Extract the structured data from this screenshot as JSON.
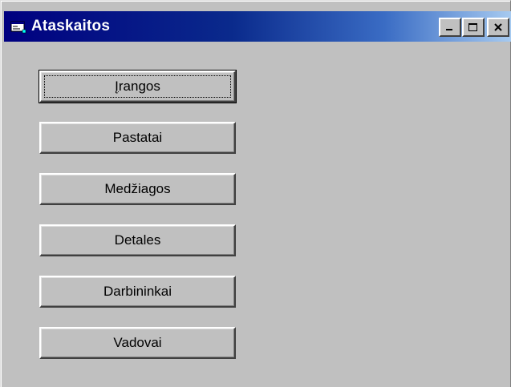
{
  "window": {
    "title": "Ataskaitos",
    "icon": "app-form-icon"
  },
  "titlebar_buttons": {
    "minimize_icon": "minimize-icon",
    "maximize_icon": "maximize-icon",
    "close_icon": "close-icon"
  },
  "buttons": [
    {
      "label_mnemonic": "Į",
      "label_rest": "rangos",
      "default": true
    },
    {
      "label": "Pastatai"
    },
    {
      "label": "Medžiagos"
    },
    {
      "label": "Detales"
    },
    {
      "label": "Darbininkai"
    },
    {
      "label": "Vadovai"
    }
  ],
  "colors": {
    "titlebar_start": "#000080",
    "titlebar_end": "#a6caf0",
    "face": "#c0c0c0"
  }
}
